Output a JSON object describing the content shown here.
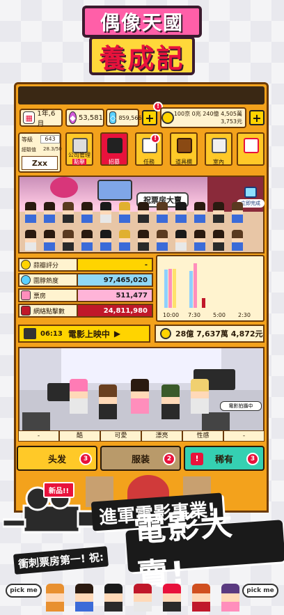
{
  "logo": {
    "title_top": "偶像天國",
    "title_bottom": "養成記"
  },
  "status": {
    "date": "1年,6月",
    "gems": "53,581",
    "tickets": "859,566",
    "money_line1": "100京 0兆 240億 4,505萬",
    "money_line2": "3,753元",
    "plus": "+",
    "alert": "!"
  },
  "profile": {
    "level_label": "等級",
    "level": "643",
    "exp_label": "經驗值",
    "exp": "28.3/50",
    "name": "Zxx"
  },
  "menu": [
    {
      "label": "公司管理",
      "sub": "點擊"
    },
    {
      "label": "招募"
    },
    {
      "label": "任務"
    },
    {
      "label": "道具欄"
    },
    {
      "label": "室內"
    }
  ],
  "scene": {
    "banner": "祝票房大賣",
    "instant": "立即完成"
  },
  "stats": {
    "rows": [
      {
        "label": "蒜瓣評分",
        "value": "-"
      },
      {
        "label": "圍脖熱度",
        "value": "97,465,020"
      },
      {
        "label": "票房",
        "value": "511,477"
      },
      {
        "label": "網絡點擊數",
        "value": "24,811,980"
      }
    ]
  },
  "chart_data": {
    "type": "bar",
    "categories": [
      "10:00",
      "7:30",
      "5:00",
      "2:30"
    ],
    "series": [
      {
        "name": "",
        "values": [
          0.78,
          0.75,
          0.0,
          0.0
        ]
      },
      {
        "name": "",
        "values": [
          0.8,
          0.92,
          0.0,
          0.0
        ]
      },
      {
        "name": "",
        "values": [
          0.8,
          0.0,
          0.0,
          0.0
        ]
      },
      {
        "name": "",
        "values": [
          0.0,
          0.2,
          0.0,
          0.0
        ]
      }
    ],
    "colors": [
      "#8fd0ff",
      "#ff8ebc",
      "#ffe16b",
      "#c0182a"
    ]
  },
  "now_showing": {
    "time": "06:13",
    "label": "電影上映中",
    "total": "28億 7,637萬 4,872元",
    "badge": "電影拍攝中"
  },
  "attributes": [
    "-",
    "酷",
    "可愛",
    "漂亮",
    "性感",
    "-"
  ],
  "tabs": [
    {
      "label": "头发",
      "badge": "3"
    },
    {
      "label": "服装",
      "badge": "2"
    },
    {
      "label": "稀有",
      "badge": "3"
    }
  ],
  "promo": {
    "new_tag": "新品!!",
    "line1": "進軍電影事業!",
    "line2_lead": "衝刺票房第一! 祝:",
    "line2": "電影大賣!"
  },
  "footer": {
    "pick_left": "pick me",
    "pick_right": "pick me"
  }
}
